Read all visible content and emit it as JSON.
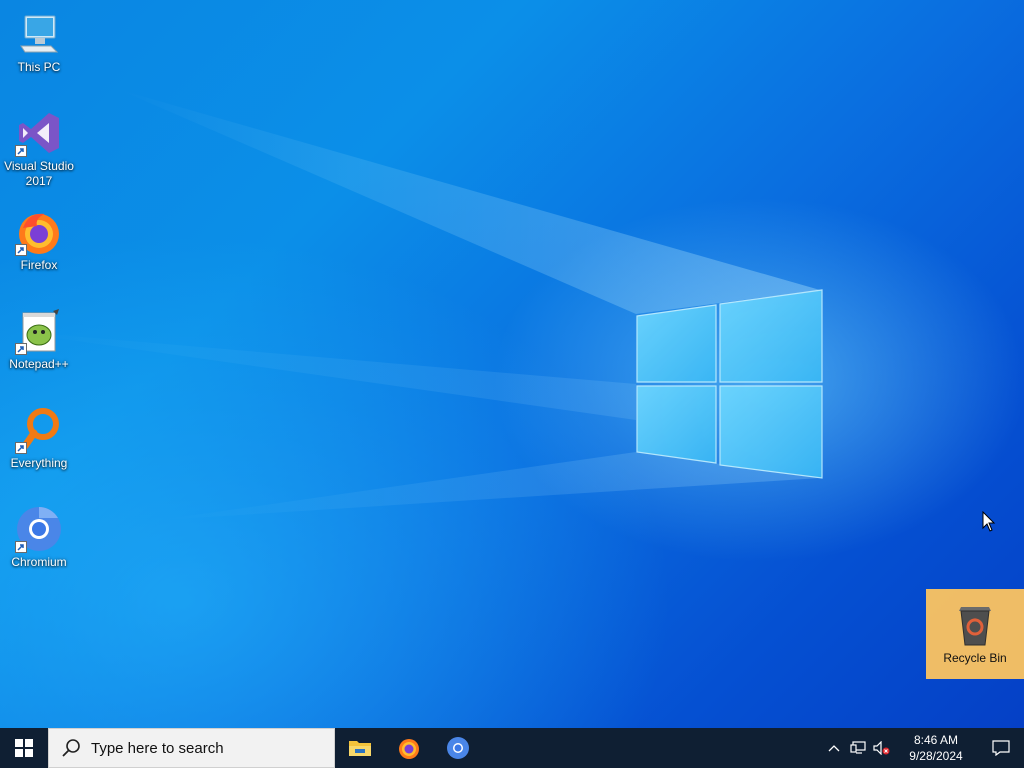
{
  "desktop": {
    "icons": [
      {
        "label": "This PC",
        "icon": "computer-icon"
      },
      {
        "label": "Visual Studio 2017",
        "icon": "visual-studio-icon"
      },
      {
        "label": "Firefox",
        "icon": "firefox-icon"
      },
      {
        "label": "Notepad++",
        "icon": "notepad-plus-plus-icon"
      },
      {
        "label": "Everything",
        "icon": "everything-search-icon"
      },
      {
        "label": "Chromium",
        "icon": "chromium-icon"
      }
    ],
    "recycle_bin": {
      "label": "Recycle Bin",
      "icon": "recycle-bin-icon"
    }
  },
  "taskbar": {
    "start_icon": "windows-start-icon",
    "search_placeholder": "Type here to search",
    "pinned_apps": [
      {
        "name": "File Explorer",
        "icon": "folder-icon"
      },
      {
        "name": "Firefox",
        "icon": "firefox-icon"
      },
      {
        "name": "Chromium",
        "icon": "chromium-icon"
      }
    ],
    "tray": {
      "icons": [
        "chevron-up-icon",
        "network-icon",
        "volume-muted-icon"
      ],
      "time": "8:46 AM",
      "date": "9/28/2024"
    },
    "notification_icon": "action-center-icon"
  },
  "colors": {
    "taskbar": "#0f1f33",
    "recycle_highlight": "#fcc460",
    "desktop_blue": "#0a86e2"
  }
}
